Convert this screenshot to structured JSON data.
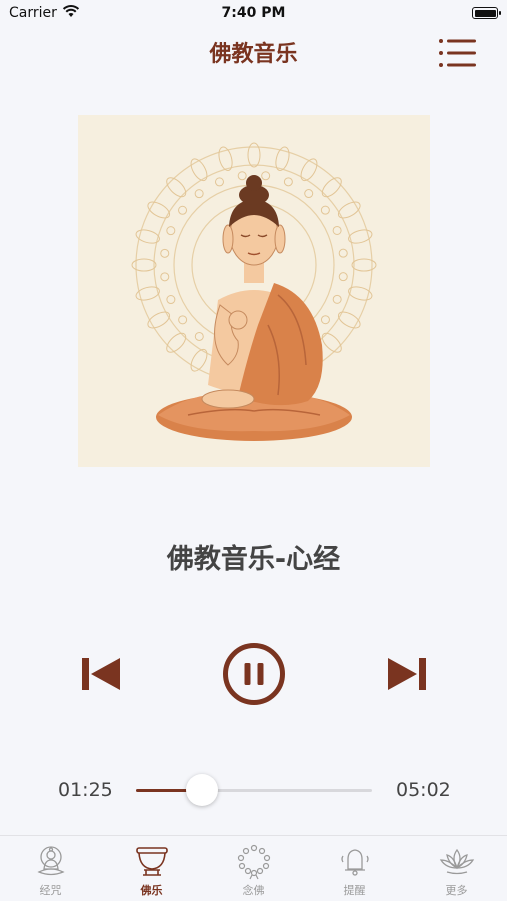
{
  "status_bar": {
    "carrier": "Carrier",
    "time": "7:40 PM"
  },
  "header": {
    "title": "佛教音乐",
    "menu_icon": "list-icon"
  },
  "player": {
    "song_title": "佛教音乐-心经",
    "current_time": "01:25",
    "total_time": "05:02",
    "progress": 0.28,
    "state": "playing"
  },
  "tabs": [
    {
      "label": "经咒",
      "icon": "buddha-icon",
      "active": false
    },
    {
      "label": "佛乐",
      "icon": "singing-bowl-icon",
      "active": true
    },
    {
      "label": "念佛",
      "icon": "prayer-beads-icon",
      "active": false
    },
    {
      "label": "提醒",
      "icon": "bell-icon",
      "active": false
    },
    {
      "label": "更多",
      "icon": "lotus-icon",
      "active": false
    }
  ],
  "colors": {
    "accent": "#7a3420",
    "background": "#f5f6fa",
    "art_background": "#f6efdf",
    "robe": "#d9824a"
  }
}
